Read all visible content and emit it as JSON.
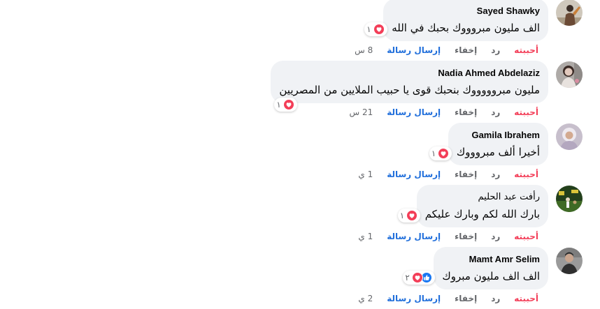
{
  "action_labels": {
    "like": "أحببته",
    "reply": "رد",
    "hide": "إخفاء",
    "send_message": "إرسال رسالة"
  },
  "comments": [
    {
      "author": "Sayed Shawky",
      "text": "الف مليون مبروووك بحبك في الله",
      "reaction_icons": [
        "heart-icon"
      ],
      "reaction_count": "١",
      "time": "8 س"
    },
    {
      "author": "Nadia Ahmed Abdelaziz",
      "text": "مليون مبروووووك بنحبك قوى يا حبيب الملايين من المصريين",
      "reaction_icons": [
        "heart-icon"
      ],
      "reaction_count": "١",
      "time": "21 س"
    },
    {
      "author": "Gamila Ibrahem",
      "text": "أخيرا ألف مبروووك",
      "reaction_icons": [
        "heart-icon"
      ],
      "reaction_count": "١",
      "time": "1 ي"
    },
    {
      "author": "رأفت عبد الحليم",
      "text": "بارك الله لكم وبارك عليكم",
      "reaction_icons": [
        "heart-icon"
      ],
      "reaction_count": "١",
      "time": "1 ي"
    },
    {
      "author": "Mamt Amr Selim",
      "text": "الف الف مليون مبروك",
      "reaction_icons": [
        "like-icon",
        "heart-icon"
      ],
      "reaction_count": "٢",
      "time": "2 ي"
    }
  ],
  "colors": {
    "liked_label": "#f33e58",
    "send_message_label": "#216fdb",
    "secondary_text": "#65676b",
    "bubble_background": "#f0f2f5",
    "heart_reaction": "#f33e58",
    "like_reaction": "#1877f2"
  }
}
